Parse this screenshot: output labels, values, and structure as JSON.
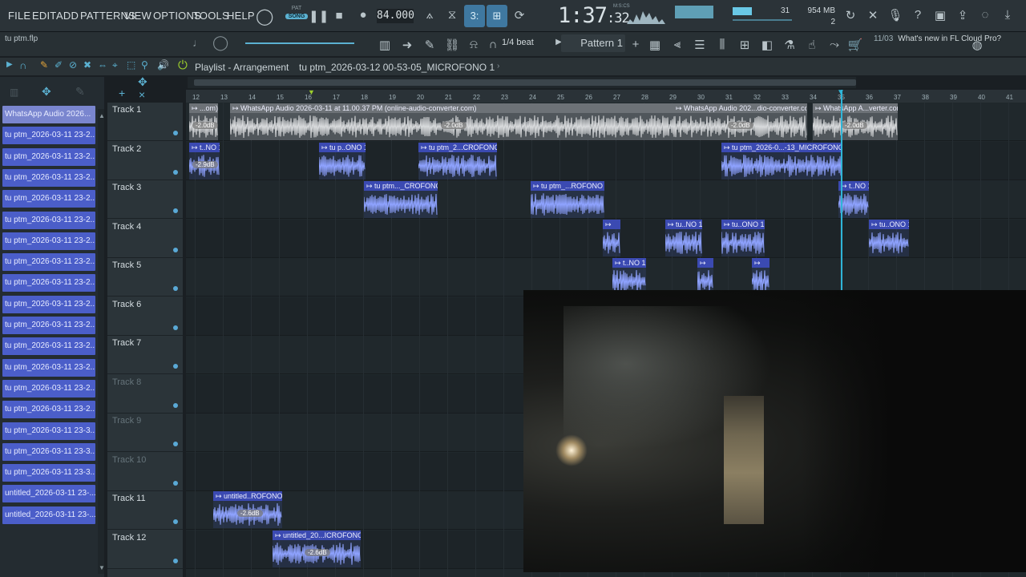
{
  "menu": [
    "FILE",
    "EDIT",
    "ADD",
    "PATTERNS",
    "VIEW",
    "OPTIONS",
    "TOOLS",
    "HELP"
  ],
  "transport": {
    "pat_label": "PAT",
    "song_label": "SONG",
    "tempo": "84.000",
    "time_main": "1:37",
    "time_sub": ":32",
    "time_mode_label": "M:S:CS"
  },
  "meters": {
    "value": "31",
    "memory": "954 MB",
    "cpu": "2"
  },
  "project_name": "tu ptm.flp",
  "snap": "1/4 beat",
  "pattern_selector": "Pattern 1",
  "news": {
    "date": "11/03",
    "text": "What's new in FL Cloud Pro?"
  },
  "playlist": {
    "title": "Playlist - Arrangement",
    "current_clip": "tu  ptm_2026-03-12 00-53-05_MICROFONO 1"
  },
  "picker": [
    "WhatsApp Audio 2026...",
    "tu  ptm_2026-03-11 23-2...",
    "tu  ptm_2026-03-11 23-2...",
    "tu  ptm_2026-03-11 23-2...",
    "tu  ptm_2026-03-11 23-2...",
    "tu  ptm_2026-03-11 23-2...",
    "tu  ptm_2026-03-11 23-2...",
    "tu  ptm_2026-03-11 23-2...",
    "tu  ptm_2026-03-11 23-2...",
    "tu  ptm_2026-03-11 23-2...",
    "tu  ptm_2026-03-11 23-2...",
    "tu  ptm_2026-03-11 23-2...",
    "tu  ptm_2026-03-11 23-2...",
    "tu  ptm_2026-03-11 23-2...",
    "tu  ptm_2026-03-11 23-2...",
    "tu  ptm_2026-03-11 23-3...",
    "tu  ptm_2026-03-11 23-3...",
    "tu  ptm_2026-03-11 23-3...",
    "untitled_2026-03-11 23-...",
    "untitled_2026-03-11 23-..."
  ],
  "tracks": [
    "Track 1",
    "Track 2",
    "Track 3",
    "Track 4",
    "Track 5",
    "Track 6",
    "Track 7",
    "Track 8",
    "Track 9",
    "Track 10",
    "Track 11",
    "Track 12"
  ],
  "ruler": [
    "12",
    "13",
    "14",
    "15",
    "16",
    "17",
    "18",
    "19",
    "20",
    "21",
    "22",
    "23",
    "24",
    "25",
    "26",
    "27",
    "28",
    "29",
    "30",
    "31",
    "32",
    "33",
    "34",
    "35",
    "36",
    "37",
    "38",
    "39",
    "40",
    "41"
  ],
  "clips": {
    "t1a": "↦ ...om)",
    "t1b": "↦ WhatsApp Audio 2026-03-11 at 11.00.37 PM (online-audio-converter.com)",
    "t1c": "↦ WhatsApp Audio 202...dio-converter.com)",
    "t1d": "↦ WhatsApp A...verter.com)",
    "t2a": "↦ t..NO 1",
    "t2b": "↦ tu  p..ONO 1",
    "t2c": "↦ tu  ptm_2...CROFONO 1",
    "t2d": "↦ tu  ptm_2026-0...-13_MICROFONO 1",
    "t3a": "↦ tu  ptm..._CROFONO 1",
    "t3b": "↦ tu  ptm_...ROFONO 1",
    "t3c": "↦ t..NO 1",
    "t4a": "↦",
    "t4b": "↦ tu..NO 1",
    "t4c": "↦ tu..ONO 1",
    "t4d": "↦ tu..ONO 1",
    "t5a": "↦ t..NO 1",
    "t5b": "↦",
    "t5c": "↦",
    "t11a": "↦ untitled..ROFONO 1",
    "t12a": "↦ untitled_20...ICROFONO 1"
  },
  "gains": {
    "g1": "-2.0dB",
    "g2": "-2.0dB",
    "g3": "-2.0dB",
    "g4": "-2.0dB",
    "g5": "-2.9dB",
    "g6": "-2.6dB",
    "g7": "-2.6dB"
  },
  "colors": {
    "accent": "#5bb1d1",
    "clip_blue": "#3b4ab2",
    "clip_grey": "#6d7277",
    "playhead": "#2fb5d8"
  }
}
